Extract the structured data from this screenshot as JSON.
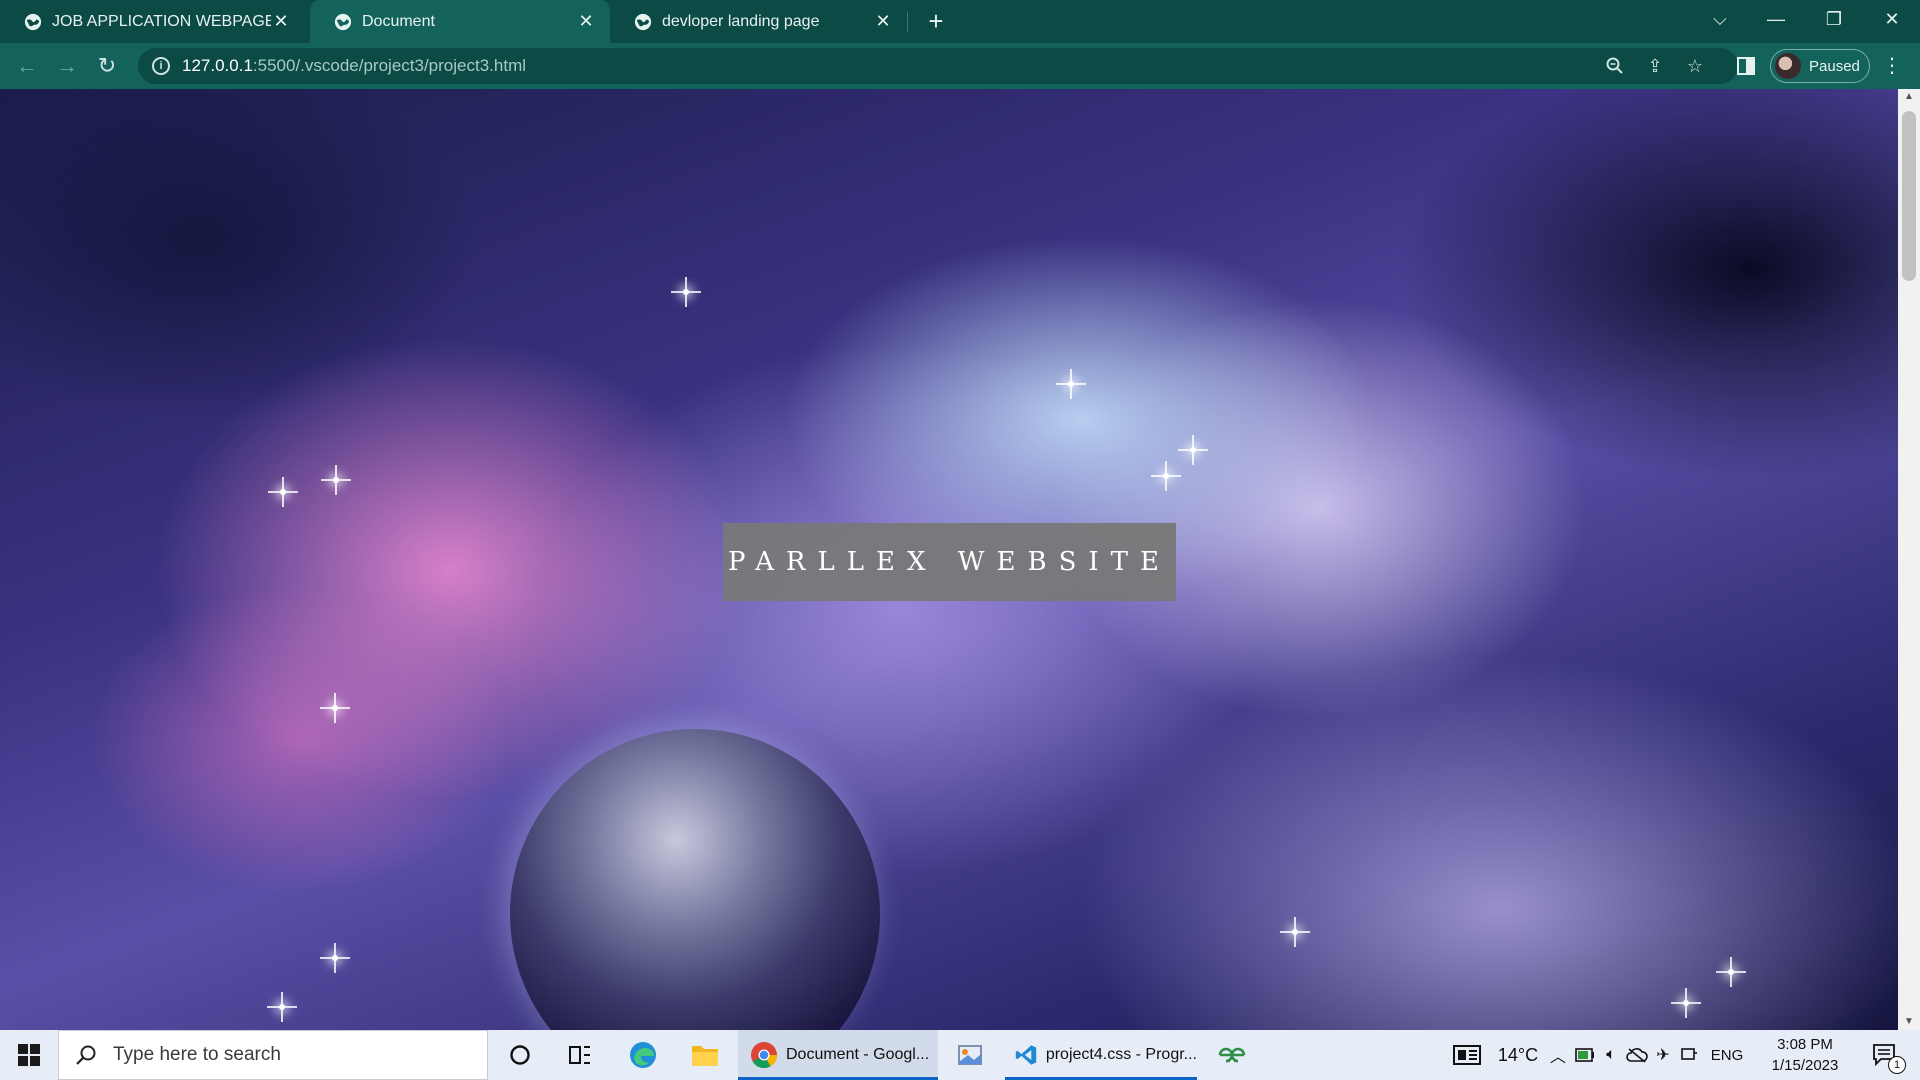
{
  "browser": {
    "tabs": [
      {
        "title": "JOB APPLICATION WEBPAGE",
        "active": false
      },
      {
        "title": "Document",
        "active": true
      },
      {
        "title": "devloper landing page",
        "active": false
      }
    ],
    "address": {
      "host": "127.0.0.1",
      "path": ":5500/.vscode/project3/project3.html"
    },
    "profile_label": "Paused"
  },
  "page": {
    "title": "PARLLEX WEBSITE"
  },
  "taskbar": {
    "search_placeholder": "Type here to search",
    "apps": [
      {
        "label": "Document - Googl..."
      },
      {
        "label": "project4.css - Progr..."
      }
    ],
    "weather": "14°C",
    "language": "ENG",
    "time": "3:08 PM",
    "date": "1/15/2023",
    "notification_count": "1"
  }
}
